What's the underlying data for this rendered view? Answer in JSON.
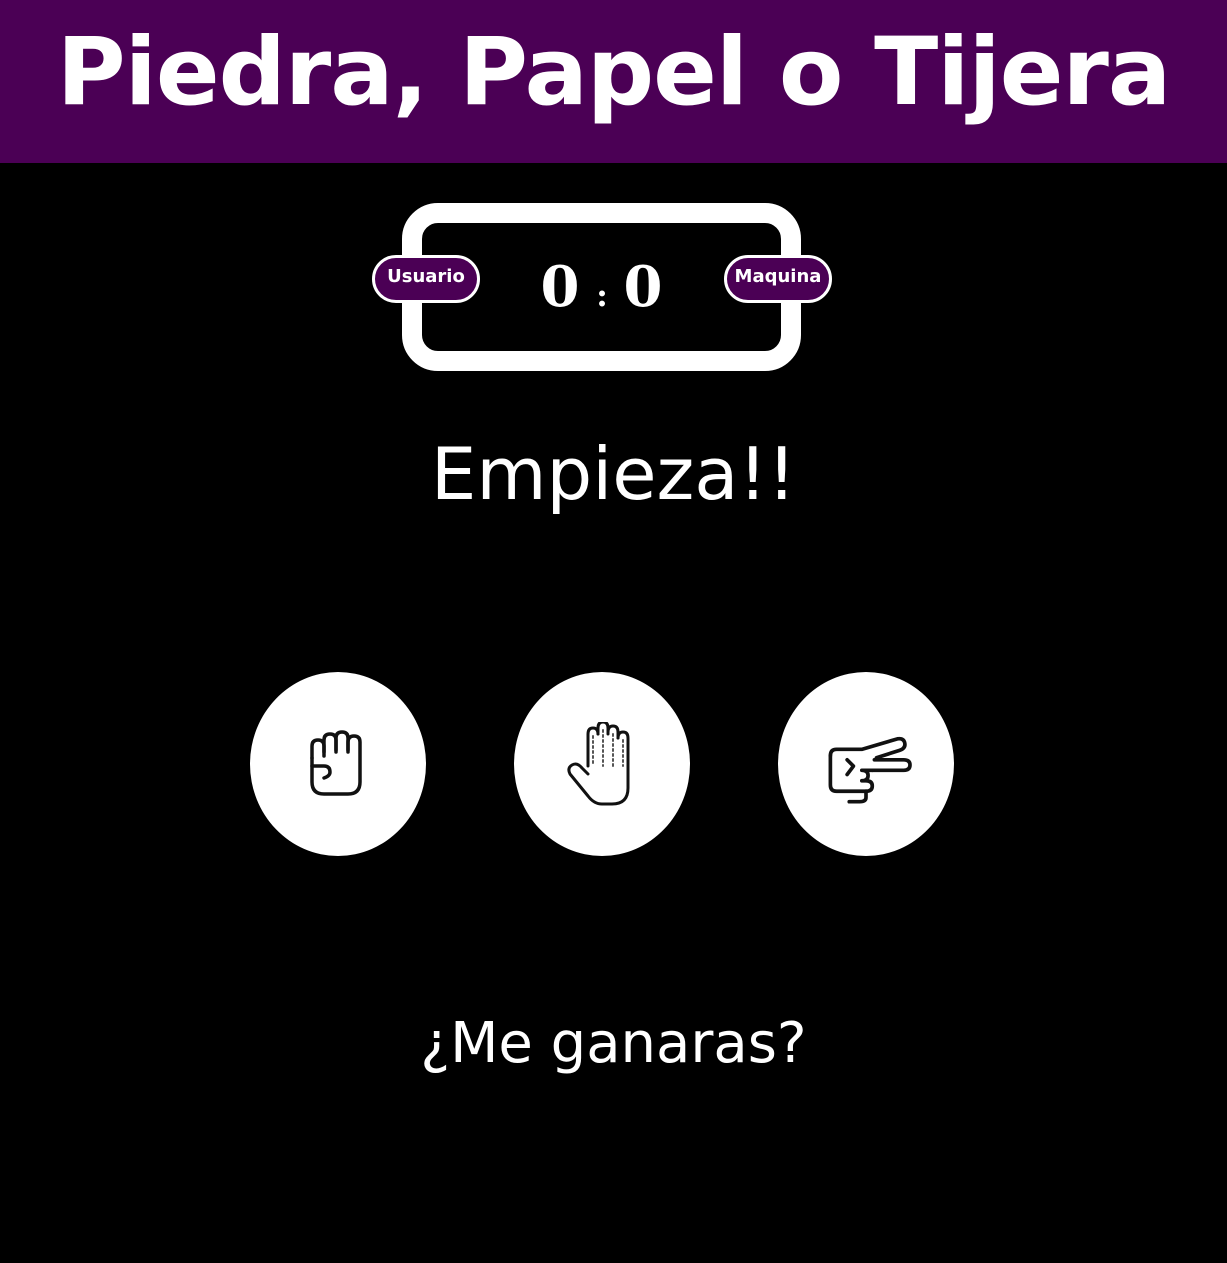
{
  "header": {
    "title": "Piedra, Papel o Tijera",
    "background_color": "#4b0055"
  },
  "scoreboard": {
    "user_label": "Usuario",
    "computer_label": "Maquina",
    "user_score": "0",
    "separator": ":",
    "computer_score": "0"
  },
  "message": "Empieza!!",
  "choices": [
    {
      "name": "piedra",
      "icon": "fist-icon"
    },
    {
      "name": "papel",
      "icon": "open-hand-icon"
    },
    {
      "name": "tijera",
      "icon": "scissors-hand-icon"
    }
  ],
  "footer_text": "¿Me ganaras?",
  "colors": {
    "accent": "#4b0055",
    "background": "#000000",
    "foreground": "#ffffff"
  }
}
